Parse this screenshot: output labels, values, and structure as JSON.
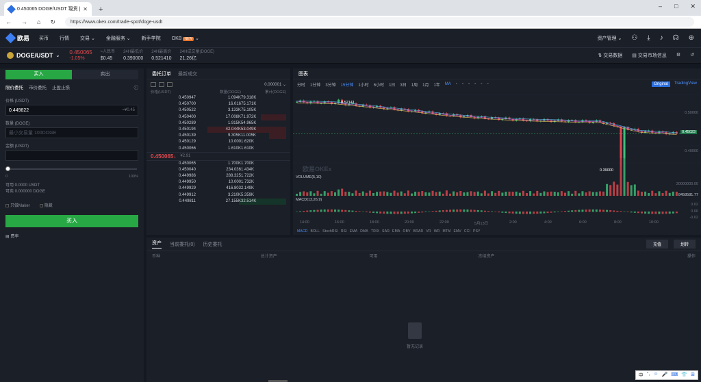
{
  "browser": {
    "tab_title": "0.450065 DOGE/USDT 現货 | 歐",
    "new_tab": "+",
    "url": "https://www.okex.com/trade-spot/doge-usdt",
    "win_min": "–",
    "win_max": "□",
    "win_close": "✕"
  },
  "nav": {
    "logo": "欧易",
    "items": [
      "买币",
      "行情",
      "交易",
      "金融服务",
      "新手学院",
      "OKB"
    ],
    "badge": "NEW",
    "assets": "资产管理"
  },
  "ticker": {
    "pair": "DOGE/USDT",
    "price": "0.450065",
    "change": "-1.05%",
    "stats": [
      {
        "label": "≈人民币",
        "value": "$0.45"
      },
      {
        "label": "24H最低价",
        "value": "0.390000"
      },
      {
        "label": "24H最高价",
        "value": "0.521410"
      },
      {
        "label": "24H成交量(DOGE)",
        "value": "21.26亿"
      }
    ],
    "right_links": [
      "交易数据",
      "交易市场信息"
    ]
  },
  "trade_form": {
    "buy_tab": "买入",
    "sell_tab": "卖出",
    "order_types": [
      "限价委托",
      "市价委托",
      "止盈止损"
    ],
    "price_label": "价格 (USDT)",
    "price_value": "0.449822",
    "price_cny": "≈¥0.45",
    "amount_label": "数量 (DOGE)",
    "amount_placeholder": "最小交易量 100DOGE",
    "total_label": "金额 (USDT)",
    "slider_min": "0",
    "slider_max": "100%",
    "avail_usdt": "可用 0.0000 USDT",
    "avail_doge": "可卖 0.000000 DOGE",
    "opt1": "只做Maker",
    "opt2": "隐藏",
    "buy_button": "买入",
    "fee_link": "费率"
  },
  "orderbook": {
    "tab_active": "委托订单",
    "tab_other": "最新成交",
    "precision": "0.000001",
    "col_price": "价格(USDT)",
    "col_amount": "数量(DOGE)",
    "col_total": "累计(DOGE)",
    "asks": [
      {
        "price": "0.450947",
        "amount": "1.094K",
        "total": "79.318K",
        "depth": 0.0
      },
      {
        "price": "0.450700",
        "amount": "16.016",
        "total": "75.171K",
        "depth": 0.0
      },
      {
        "price": "0.450522",
        "amount": "3.133K",
        "total": "75.105K",
        "depth": 0.0
      },
      {
        "price": "0.450400",
        "amount": "17.008K",
        "total": "71.972K",
        "depth": 0.32
      },
      {
        "price": "0.450289",
        "amount": "1.915K",
        "total": "54.965K",
        "depth": 0.0
      },
      {
        "price": "0.450194",
        "amount": "42.044K",
        "total": "53.049K",
        "depth": 1.0
      },
      {
        "price": "0.450139",
        "amount": "9.305K",
        "total": "11.005K",
        "depth": 0.22
      },
      {
        "price": "0.450129",
        "amount": "10.000",
        "total": "1.620K",
        "depth": 0.0
      },
      {
        "price": "0.450066",
        "amount": "1.610K",
        "total": "1.610K",
        "depth": 0.0
      }
    ],
    "mid_price": "0.450065↓",
    "mid_cny": "¥2.91",
    "bids": [
      {
        "price": "0.450065",
        "amount": "1.700K",
        "total": "1.700K",
        "depth": 0.0
      },
      {
        "price": "0.450040",
        "amount": "234.036",
        "total": "1.434K",
        "depth": 0.0
      },
      {
        "price": "0.449986",
        "amount": "288.325",
        "total": "1.722K",
        "depth": 0.0
      },
      {
        "price": "0.449950",
        "amount": "10.000",
        "total": "1.732K",
        "depth": 0.0
      },
      {
        "price": "0.449929",
        "amount": "416.803",
        "total": "2.149K",
        "depth": 0.0
      },
      {
        "price": "0.449912",
        "amount": "3.210K",
        "total": "5.359K",
        "depth": 0.0
      },
      {
        "price": "0.449811",
        "amount": "27.155K",
        "total": "32.514K",
        "depth": 0.6
      }
    ]
  },
  "chart": {
    "title": "图表",
    "intervals": [
      "分时",
      "1分钟",
      "3分钟",
      "15分钟",
      "1小时",
      "6小时",
      "1日",
      "3日",
      "1周",
      "1月",
      "1年"
    ],
    "active_interval": "15分钟",
    "ma": "MA",
    "original": "Original",
    "tradingview": "TradingView",
    "high_label": "0.52141",
    "low_label": "0.39000",
    "price_axis": [
      "0.50000",
      "0.45023",
      "0.40000"
    ],
    "last_price": "0.45023",
    "volume_label": "VOLUME(5,10)",
    "volume_axis": "20000000.00",
    "volume_value": "8458581.77",
    "macd_label": "MACD(12,26,9)",
    "macd_axis": [
      "0.02",
      "0.00",
      "-0.02"
    ],
    "time_axis": [
      "14:00",
      "16:00",
      "18:00",
      "20:00",
      "22:00",
      "5月13日",
      "2:00",
      "4:00",
      "6:00",
      "8:00",
      "10:00"
    ],
    "indicators": [
      "MACD",
      "BOLL",
      "StochRSI",
      "RSI",
      "EMA",
      "DMA",
      "TRIX",
      "SAR",
      "EMA",
      "OBV",
      "BRAR",
      "VR",
      "WR",
      "MTM",
      "EMV",
      "CCI",
      "PSY"
    ],
    "watermark": "欧易OKEx"
  },
  "chart_data": {
    "type": "candlestick",
    "x": [
      "14:00",
      "16:00",
      "18:00",
      "20:00",
      "22:00",
      "5月13日",
      "2:00",
      "4:00",
      "6:00",
      "8:00",
      "10:00"
    ],
    "close": [
      0.515,
      0.513,
      0.505,
      0.497,
      0.488,
      0.482,
      0.478,
      0.476,
      0.474,
      0.455,
      0.45
    ],
    "ylim": [
      0.39,
      0.53
    ],
    "annotations": {
      "high": 0.52141,
      "low": 0.39,
      "last": 0.45023
    }
  },
  "orders": {
    "tabs": [
      "资产",
      "当前委托(0)",
      "历史委托"
    ],
    "btn1": "充值",
    "btn2": "划转",
    "cols": [
      "币种",
      "总计资产",
      "可用",
      "冻结资产",
      "操作"
    ],
    "empty": "暂无记录"
  },
  "ime": [
    "中",
    "°,",
    "☺",
    "🎤",
    "⌨",
    "👕",
    "⊞"
  ]
}
